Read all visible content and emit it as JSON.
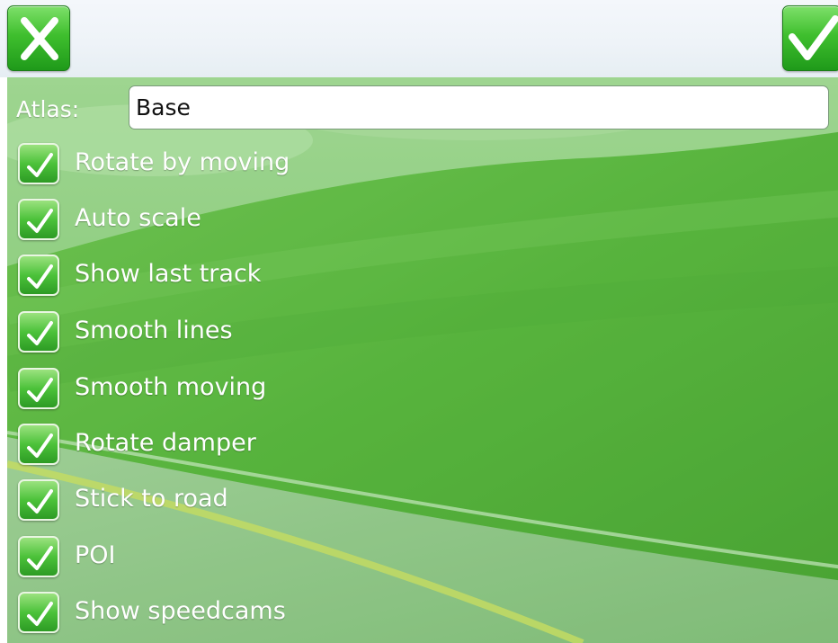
{
  "header": {
    "cancel_icon": "close-x-icon",
    "ok_icon": "checkmark-icon"
  },
  "atlas": {
    "label": "Atlas:",
    "value": "Base"
  },
  "options": [
    {
      "label": "Rotate by moving",
      "checked": true
    },
    {
      "label": "Auto scale",
      "checked": true
    },
    {
      "label": "Show last track",
      "checked": true
    },
    {
      "label": "Smooth lines",
      "checked": true
    },
    {
      "label": "Smooth moving",
      "checked": true
    },
    {
      "label": "Rotate damper",
      "checked": true
    },
    {
      "label": "Stick to road",
      "checked": true
    },
    {
      "label": "POI",
      "checked": true
    },
    {
      "label": "Show speedcams",
      "checked": true
    }
  ],
  "colors": {
    "accent_green": "#3fbf2e",
    "grass": "#5fb43a",
    "road": "#8fbf88",
    "road_line": "#d8e060"
  }
}
